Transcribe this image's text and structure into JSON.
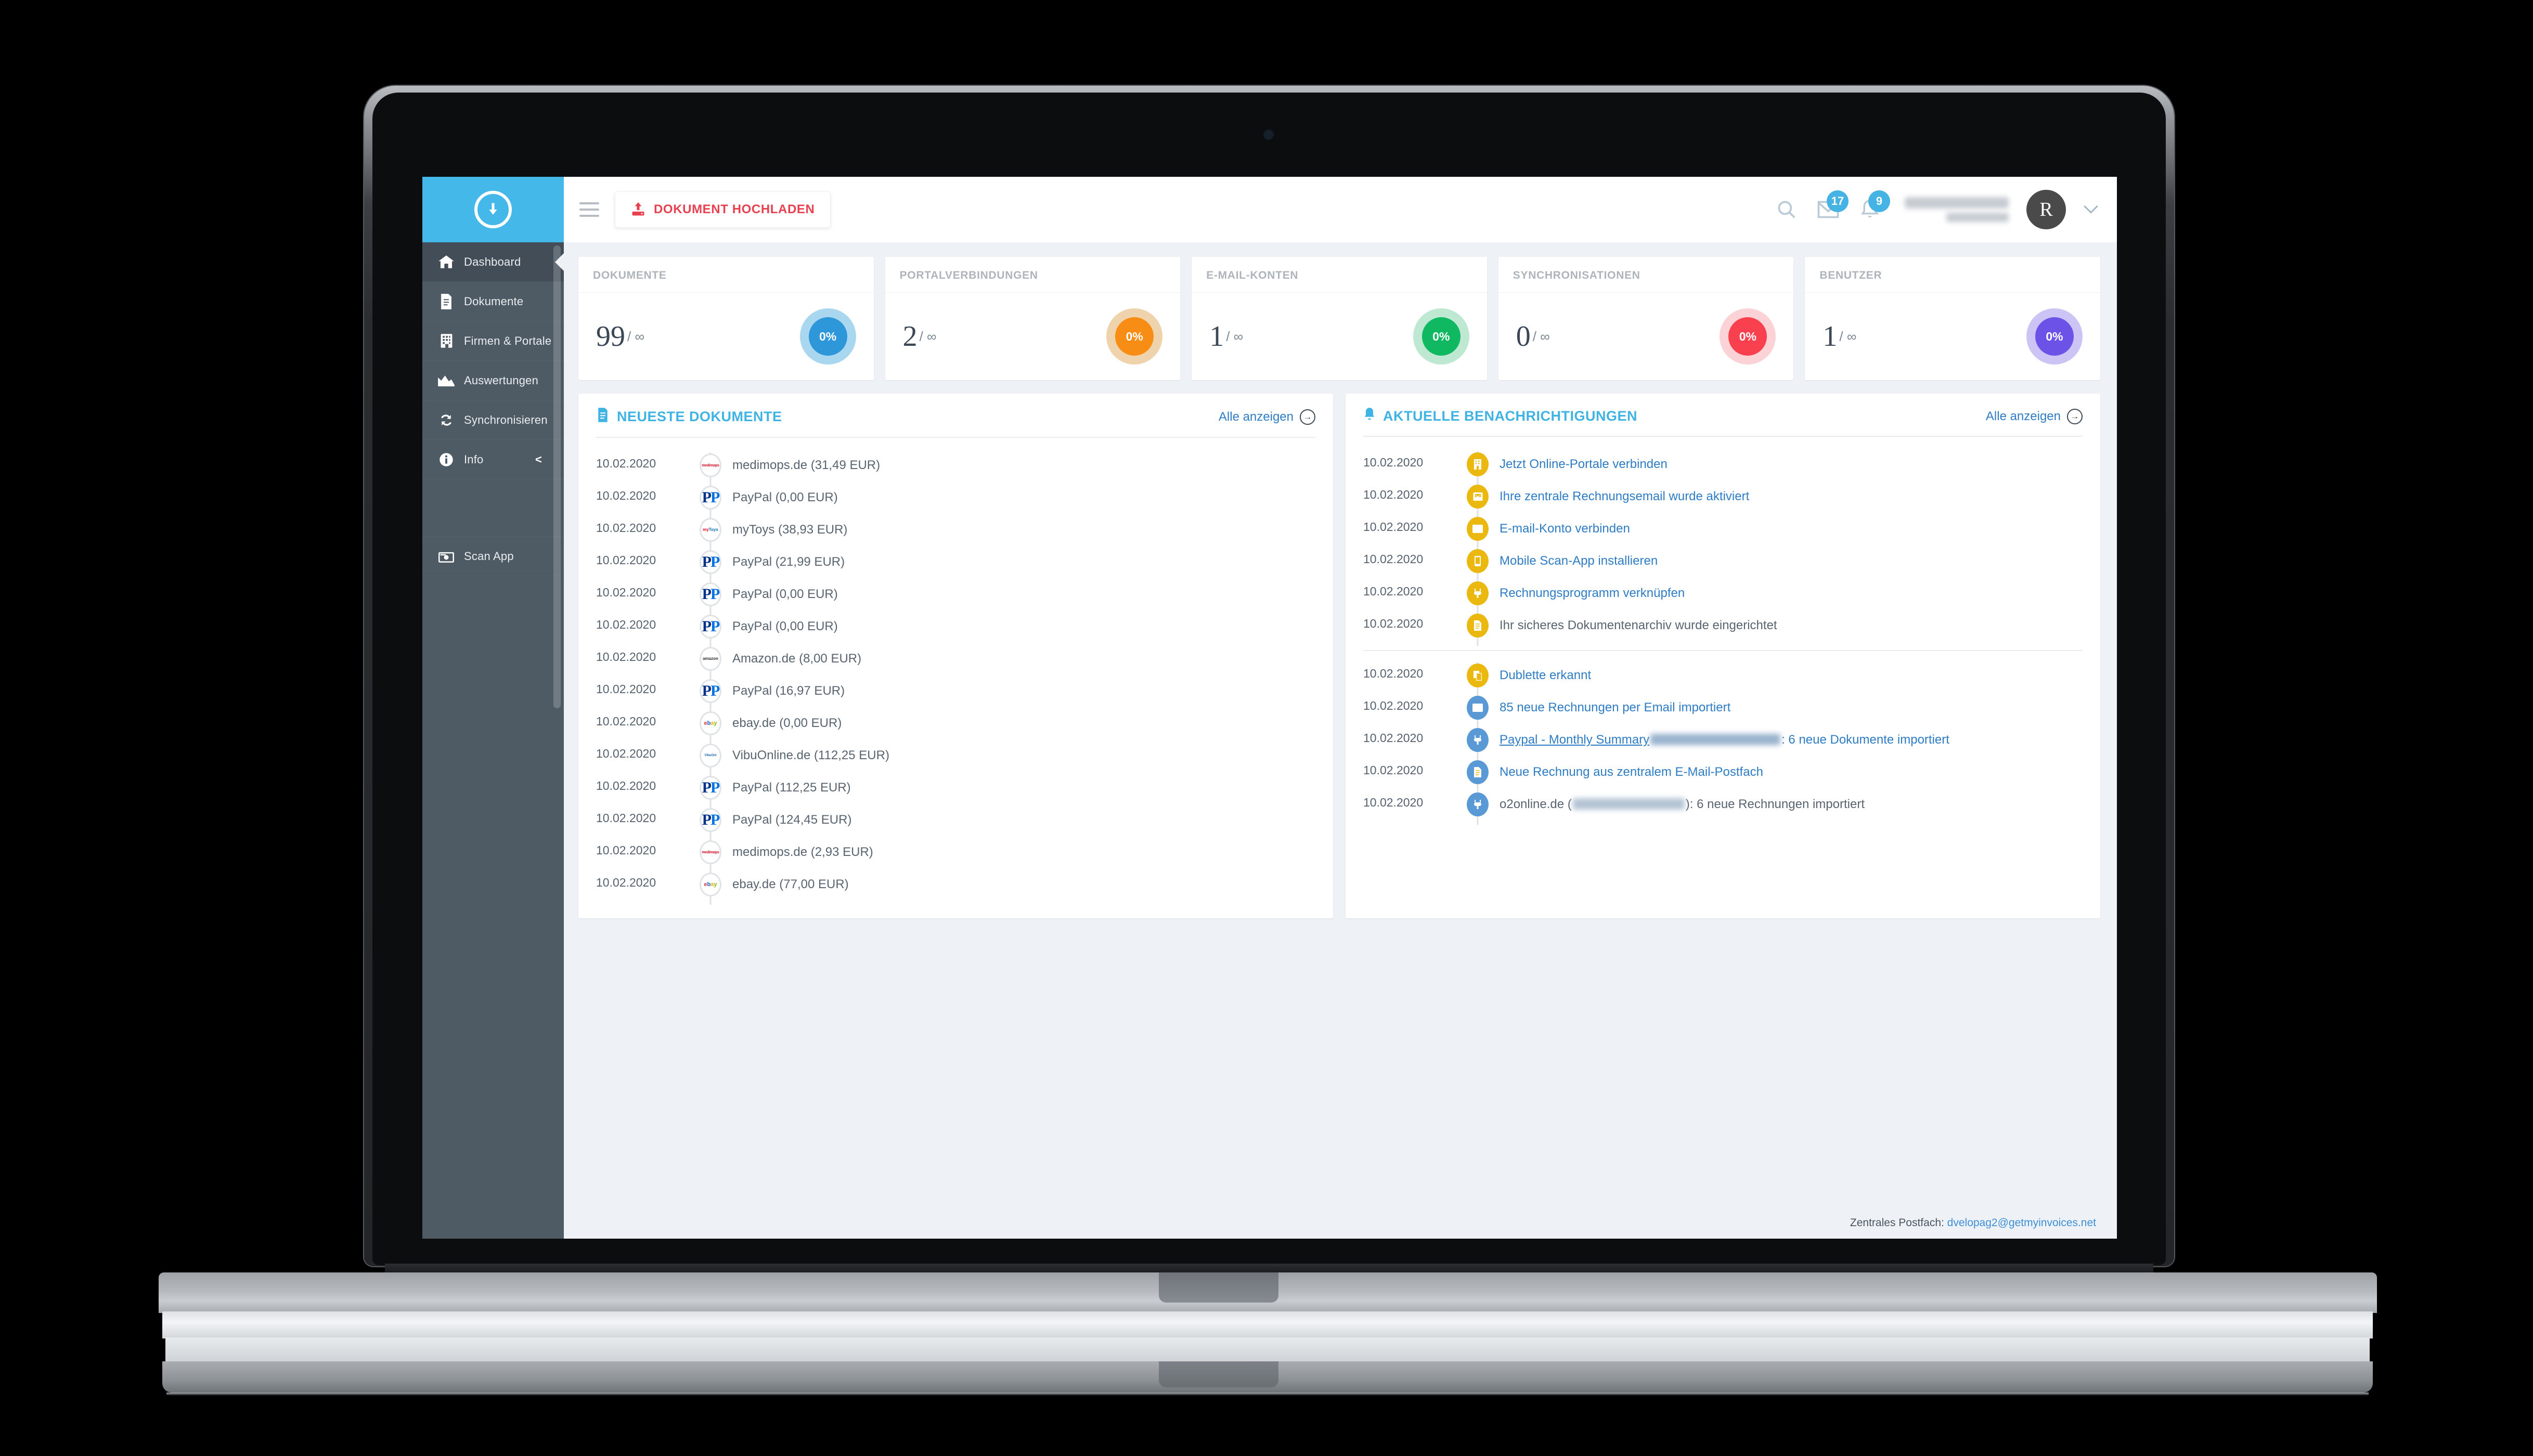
{
  "brand": {
    "accent": "#44b8e8",
    "sidebar_bg": "#4e5a64",
    "upload_color": "#e8404f"
  },
  "sidebar": {
    "logo_name": "download-circle-logo",
    "items": [
      {
        "label": "Dashboard",
        "icon": "home-icon",
        "active": true
      },
      {
        "label": "Dokumente",
        "icon": "document-icon",
        "active": false
      },
      {
        "label": "Firmen & Portale",
        "icon": "building-icon",
        "active": false
      },
      {
        "label": "Auswertungen",
        "icon": "chart-area-icon",
        "active": false
      },
      {
        "label": "Synchronisieren",
        "icon": "refresh-icon",
        "active": false
      },
      {
        "label": "Info",
        "icon": "info-icon",
        "active": false,
        "chevron": "<"
      }
    ],
    "bottom_item": {
      "label": "Scan App",
      "icon": "camera-icon"
    }
  },
  "topbar": {
    "menu_icon": "hamburger-icon",
    "upload_label": "DOKUMENT HOCHLADEN",
    "upload_icon": "upload-icon",
    "search_icon": "search-icon",
    "mail_icon": "envelope-icon",
    "mail_badge": "17",
    "bell_icon": "bell-icon",
    "bell_badge": "9",
    "avatar_initial": "R",
    "caret": "⌄"
  },
  "stats": [
    {
      "title": "DOKUMENTE",
      "value": "99",
      "limit": "/ ∞",
      "percent": "0%",
      "color": "#2e97d9",
      "ring": "#a9d7ef"
    },
    {
      "title": "PORTALVERBINDUNGEN",
      "value": "2",
      "limit": "/ ∞",
      "percent": "0%",
      "color": "#f78d14",
      "ring": "#efd3ad"
    },
    {
      "title": "E-MAIL-KONTEN",
      "value": "1",
      "limit": "/ ∞",
      "percent": "0%",
      "color": "#10b961",
      "ring": "#bfe8d2"
    },
    {
      "title": "SYNCHRONISATIONEN",
      "value": "0",
      "limit": "/ ∞",
      "percent": "0%",
      "color": "#f8404f",
      "ring": "#fbd3d6"
    },
    {
      "title": "BENUTZER",
      "value": "1",
      "limit": "/ ∞",
      "percent": "0%",
      "color": "#6d52e8",
      "ring": "#ccc4f5"
    }
  ],
  "documents_panel": {
    "title": "NEUESTE DOKUMENTE",
    "title_icon": "document-icon",
    "link_label": "Alle anzeigen",
    "link_icon": "arrow-right-circle-icon",
    "rows": [
      {
        "date": "10.02.2020",
        "text": "medimops.de (31,49 EUR)",
        "logo": "medimops"
      },
      {
        "date": "10.02.2020",
        "text": "PayPal (0,00 EUR)",
        "logo": "paypal"
      },
      {
        "date": "10.02.2020",
        "text": "myToys (38,93 EUR)",
        "logo": "mytoys"
      },
      {
        "date": "10.02.2020",
        "text": "PayPal (21,99 EUR)",
        "logo": "paypal"
      },
      {
        "date": "10.02.2020",
        "text": "PayPal (0,00 EUR)",
        "logo": "paypal"
      },
      {
        "date": "10.02.2020",
        "text": "PayPal (0,00 EUR)",
        "logo": "paypal"
      },
      {
        "date": "10.02.2020",
        "text": "Amazon.de (8,00 EUR)",
        "logo": "amazon"
      },
      {
        "date": "10.02.2020",
        "text": "PayPal (16,97 EUR)",
        "logo": "paypal"
      },
      {
        "date": "10.02.2020",
        "text": "ebay.de (0,00 EUR)",
        "logo": "ebay"
      },
      {
        "date": "10.02.2020",
        "text": "VibuOnline.de (112,25 EUR)",
        "logo": "vibu"
      },
      {
        "date": "10.02.2020",
        "text": "PayPal (112,25 EUR)",
        "logo": "paypal"
      },
      {
        "date": "10.02.2020",
        "text": "PayPal (124,45 EUR)",
        "logo": "paypal"
      },
      {
        "date": "10.02.2020",
        "text": "medimops.de (2,93 EUR)",
        "logo": "medimops"
      },
      {
        "date": "10.02.2020",
        "text": "ebay.de (77,00 EUR)",
        "logo": "ebay"
      }
    ]
  },
  "notifications_panel": {
    "title": "AKTUELLE BENACHRICHTIGUNGEN",
    "title_icon": "bell-icon",
    "link_label": "Alle anzeigen",
    "link_icon": "arrow-right-circle-icon",
    "group_one": [
      {
        "date": "10.02.2020",
        "text": "Jetzt Online-Portale verbinden",
        "icon": "building-icon",
        "bullet": "yellow",
        "style": "link"
      },
      {
        "date": "10.02.2020",
        "text": "Ihre zentrale Rechnungsemail wurde aktiviert",
        "icon": "inbox-icon",
        "bullet": "yellow",
        "style": "link"
      },
      {
        "date": "10.02.2020",
        "text": "E-mail-Konto verbinden",
        "icon": "envelope-icon",
        "bullet": "yellow",
        "style": "link"
      },
      {
        "date": "10.02.2020",
        "text": "Mobile Scan-App installieren",
        "icon": "mobile-icon",
        "bullet": "yellow",
        "style": "link"
      },
      {
        "date": "10.02.2020",
        "text": "Rechnungsprogramm verknüpfen",
        "icon": "plug-icon",
        "bullet": "yellow",
        "style": "link"
      },
      {
        "date": "10.02.2020",
        "text": "Ihr sicheres Dokumentenarchiv wurde eingerichtet",
        "icon": "document-icon",
        "bullet": "yellow",
        "style": "plain"
      }
    ],
    "group_two": [
      {
        "date": "10.02.2020",
        "text": "Dublette erkannt",
        "icon": "copy-icon",
        "bullet": "yellow",
        "style": "link"
      },
      {
        "date": "10.02.2020",
        "text": "85 neue Rechnungen per Email importiert",
        "icon": "envelope-icon",
        "bullet": "blue",
        "style": "link"
      },
      {
        "date": "10.02.2020",
        "text_before": "Paypal - Monthly Summary",
        "redacted": true,
        "text_after": ": 6 neue Dokumente importiert",
        "icon": "plug-icon",
        "bullet": "blue",
        "style": "link-underline"
      },
      {
        "date": "10.02.2020",
        "text": "Neue Rechnung aus zentralem E-Mail-Postfach",
        "icon": "document-icon",
        "bullet": "blue",
        "style": "link"
      },
      {
        "date": "10.02.2020",
        "text_before": "o2online.de (",
        "redacted": true,
        "text_after": "): 6 neue Rechnungen importiert",
        "icon": "plug-icon",
        "bullet": "blue",
        "style": "plain"
      }
    ]
  },
  "footer": {
    "label": "Zentrales Postfach:",
    "email": "dvelopag2@getmyinvoices.net"
  }
}
